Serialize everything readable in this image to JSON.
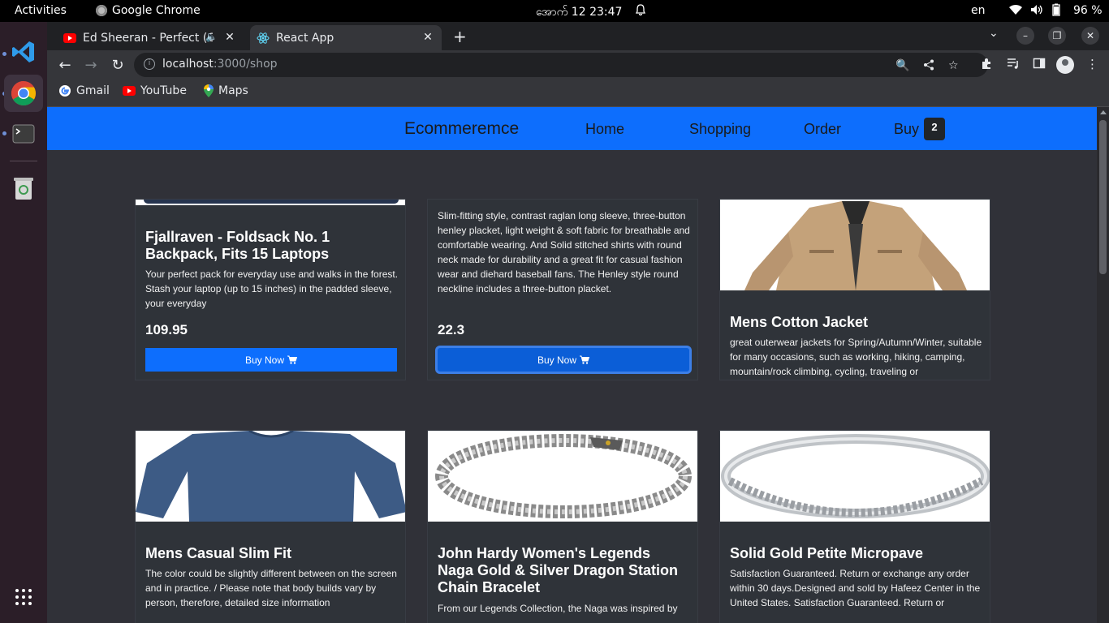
{
  "system": {
    "activities": "Activities",
    "app_name": "Google Chrome",
    "clock": "အောက် 12  23:47",
    "lang": "en",
    "battery": "96 %"
  },
  "browser": {
    "tabs": [
      {
        "title": "Ed Sheeran - Perfect (C"
      },
      {
        "title": "React App"
      }
    ],
    "url_host": "localhost",
    "url_path": ":3000/shop",
    "bookmarks": [
      {
        "label": "Gmail"
      },
      {
        "label": "YouTube"
      },
      {
        "label": "Maps"
      }
    ]
  },
  "app": {
    "brand": "Ecommeremce",
    "nav": [
      {
        "label": "Home"
      },
      {
        "label": "Shopping"
      },
      {
        "label": "Order"
      },
      {
        "label": "Buy"
      }
    ],
    "cart_count": "2"
  },
  "products": [
    {
      "title": "Fjallraven - Foldsack No. 1 Backpack, Fits 15 Laptops",
      "description": "Your perfect pack for everyday use and walks in the forest. Stash your laptop (up to 15 inches) in the padded sleeve, your everyday",
      "price": "109.95",
      "buy_label": "Buy Now"
    },
    {
      "title": "",
      "description": "Slim-fitting style, contrast raglan long sleeve, three-button henley placket, light weight & soft fabric for breathable and comfortable wearing. And Solid stitched shirts with round neck made for durability and a great fit for casual fashion wear and diehard baseball fans. The Henley style round neckline includes a three-button placket.",
      "price": "22.3",
      "buy_label": "Buy Now"
    },
    {
      "title": "Mens Cotton Jacket",
      "description": "great outerwear jackets for Spring/Autumn/Winter, suitable for many occasions, such as working, hiking, camping, mountain/rock climbing, cycling, traveling or",
      "price": "",
      "buy_label": ""
    },
    {
      "title": "Mens Casual Slim Fit",
      "description": "The color could be slightly different between on the screen and in practice. / Please note that body builds vary by person, therefore, detailed size information",
      "price": "",
      "buy_label": ""
    },
    {
      "title": "John Hardy Women's Legends Naga Gold & Silver Dragon Station Chain Bracelet",
      "description": "From our Legends Collection, the Naga was inspired by",
      "price": "",
      "buy_label": ""
    },
    {
      "title": "Solid Gold Petite Micropave",
      "description": "Satisfaction Guaranteed. Return or exchange any order within 30 days.Designed and sold by Hafeez Center in the United States. Satisfaction Guaranteed. Return or",
      "price": "",
      "buy_label": ""
    }
  ]
}
